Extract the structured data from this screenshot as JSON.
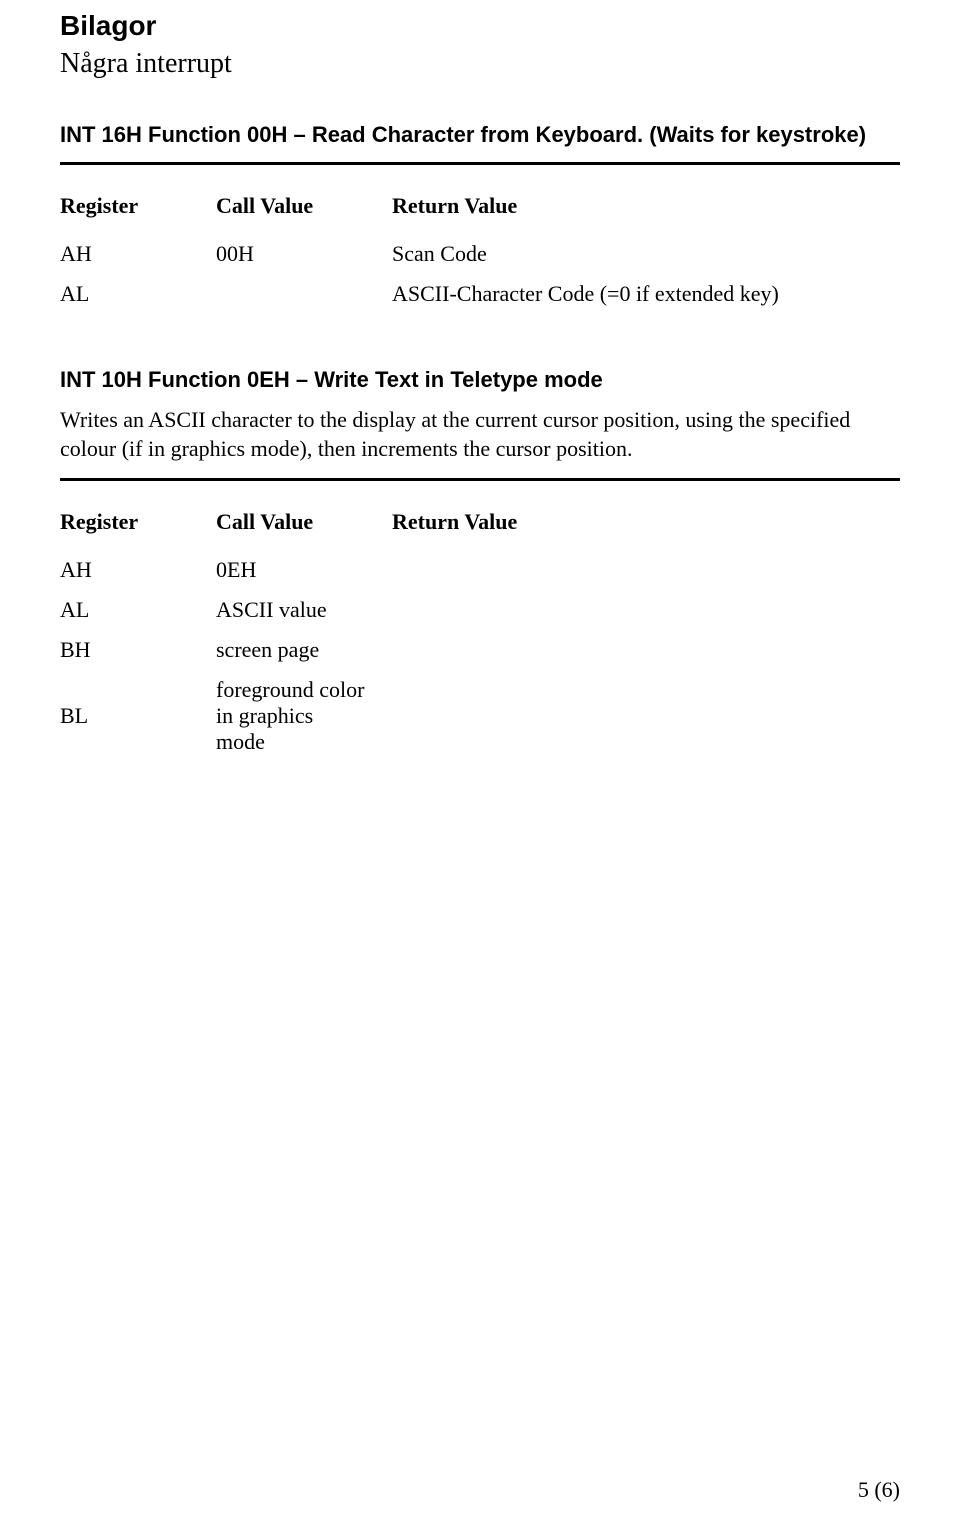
{
  "page": {
    "title": "Bilagor",
    "subtitle": "Några interrupt",
    "pageNumber": "5 (6)"
  },
  "section1": {
    "heading": "INT 16H Function 00H – Read Character from Keyboard. (Waits for keystroke)",
    "headers": {
      "register": "Register",
      "call": "Call Value",
      "ret": "Return Value"
    },
    "rows": [
      {
        "reg": "AH",
        "call": "00H",
        "ret": "Scan Code"
      },
      {
        "reg": "AL",
        "call": "",
        "ret": "ASCII-Character Code (=0 if extended key)"
      }
    ]
  },
  "section2": {
    "heading": "INT 10H Function 0EH – Write Text in Teletype mode",
    "description": "Writes an ASCII character to the display at the current cursor position, using the specified colour (if in graphics mode), then increments the cursor position.",
    "headers": {
      "register": "Register",
      "call": "Call Value",
      "ret": "Return Value"
    },
    "rows": [
      {
        "reg": "AH",
        "call": "0EH",
        "ret": ""
      },
      {
        "reg": "AL",
        "call": "ASCII value",
        "ret": ""
      },
      {
        "reg": "BH",
        "call": "screen page",
        "ret": ""
      },
      {
        "reg": "BL",
        "call": "foreground color in graphics mode",
        "ret": ""
      }
    ]
  }
}
